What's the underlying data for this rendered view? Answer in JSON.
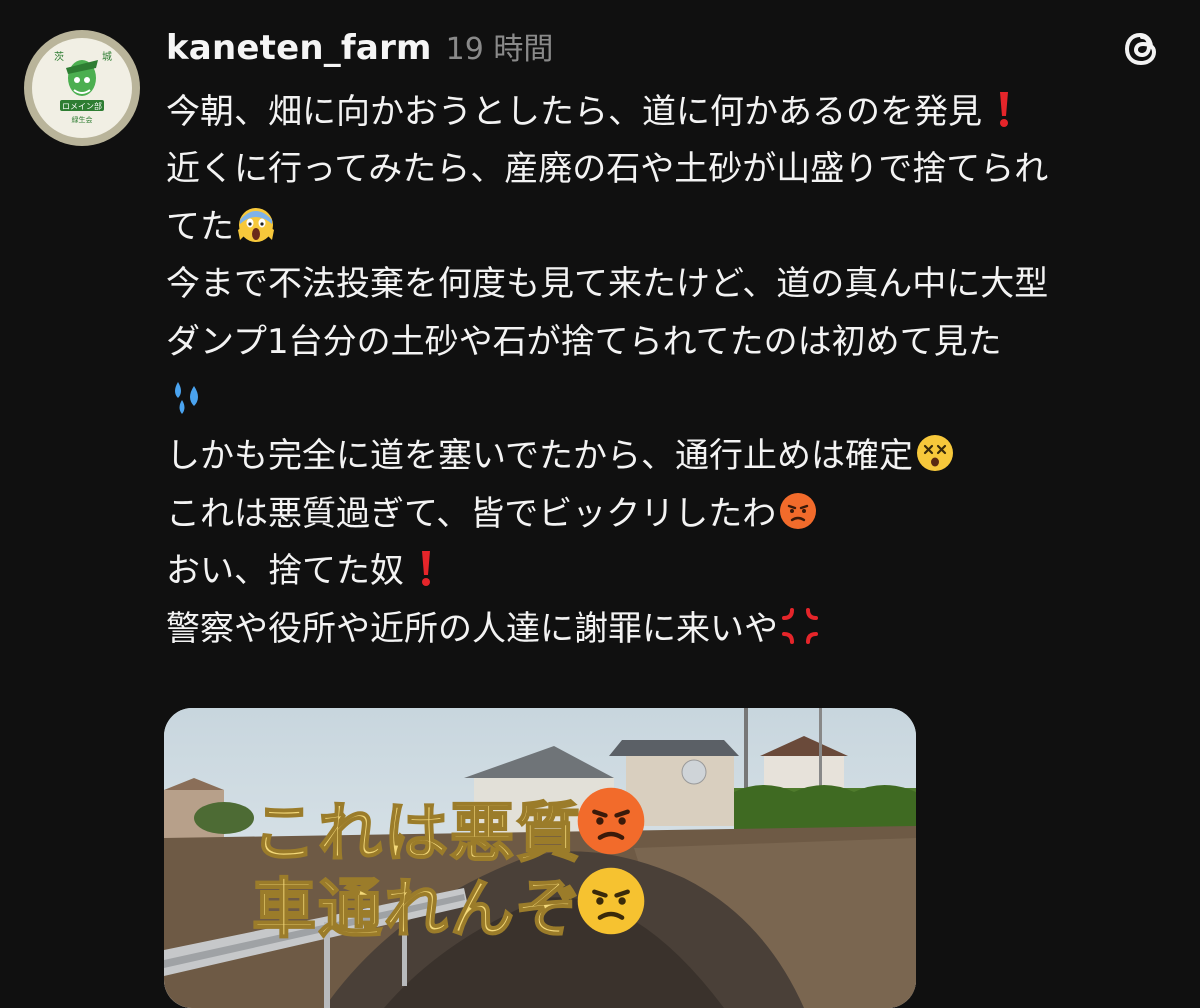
{
  "post": {
    "username": "kaneten_farm",
    "timestamp": "19 時間",
    "avatar_text": {
      "top_left": "茨",
      "top_right": "城",
      "banner": "ロメイン部",
      "bottom": "緑生会"
    },
    "lines": [
      {
        "text": "今朝、畑に向かおうとしたら、道に何かあるのを発見",
        "emoji": "exclamation-icon"
      },
      {
        "text": "近くに行ってみたら、産廃の石や土砂が山盛りで捨てられ",
        "emoji": null
      },
      {
        "text": "てた",
        "emoji": "screaming-face-icon"
      },
      {
        "text": "今まで不法投棄を何度も見て来たけど、道の真ん中に大型",
        "emoji": null
      },
      {
        "text": "ダンプ1台分の土砂や石が捨てられてたのは初めて見た",
        "emoji": null
      },
      {
        "text": "",
        "emoji": "sweat-droplets-icon"
      },
      {
        "text": "しかも完全に道を塞いでたから、通行止めは確定",
        "emoji": "dizzy-face-icon"
      },
      {
        "text": "これは悪質過ぎて、皆でビックリしたわ",
        "emoji": "angry-face-icon"
      },
      {
        "text": "おい、捨てた奴",
        "emoji": "exclamation-icon"
      },
      {
        "text": "警察や役所や近所の人達に謝罪に来いや",
        "emoji": "anger-symbol-icon"
      }
    ],
    "media": {
      "overlay_line1": "これは悪質",
      "overlay_line2": "車通れんぞ",
      "overlay_emoji": "pouting-face-icon"
    }
  },
  "colors": {
    "background": "#101010",
    "text": "#f3f3f3",
    "muted": "#8a8a8a",
    "overlay_text": "#f3d879"
  }
}
